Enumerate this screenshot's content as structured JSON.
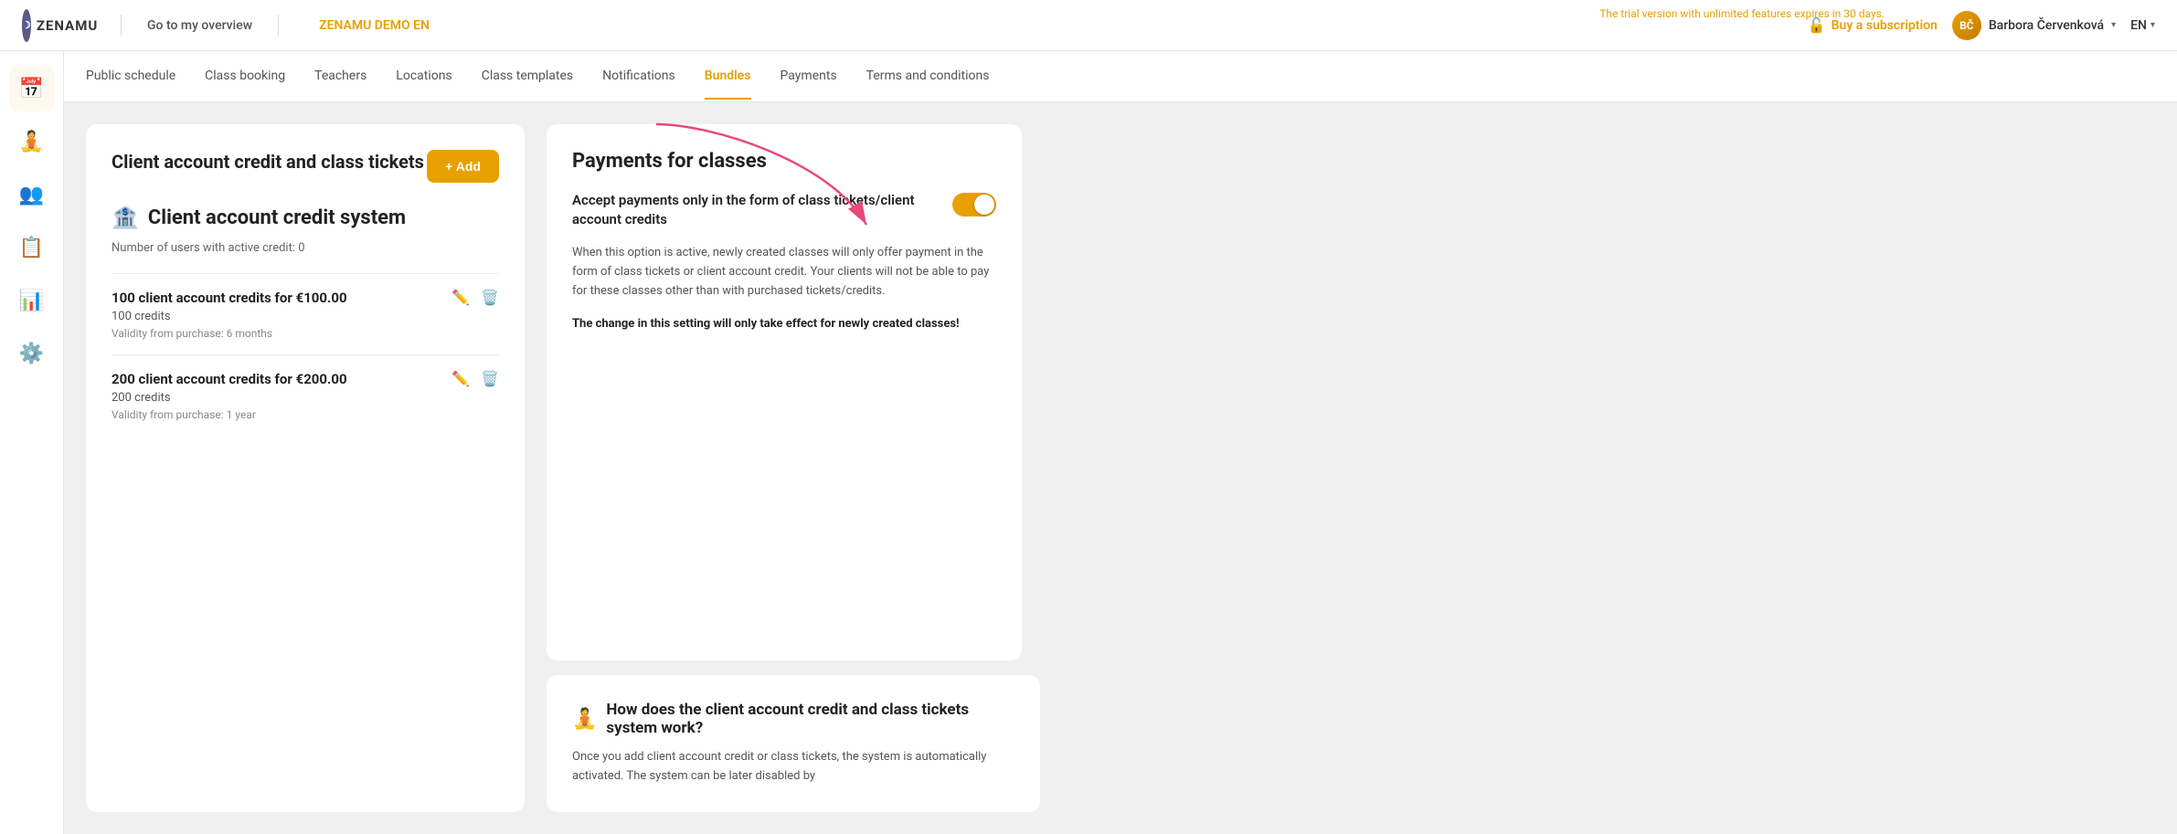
{
  "topbar": {
    "logo_text": "ZENAMU",
    "logo_initials": "Z",
    "go_to_overview": "Go to my overview",
    "demo_label": "ZENAMU DEMO EN",
    "trial_notice": "The trial version with unlimited features expires in 30 days.",
    "buy_subscription": "Buy a subscription",
    "user_initials": "BČ",
    "user_name": "Barbora Červenková",
    "language": "EN"
  },
  "nav_tabs": [
    {
      "id": "public-schedule",
      "label": "Public schedule",
      "active": false
    },
    {
      "id": "class-booking",
      "label": "Class booking",
      "active": false
    },
    {
      "id": "teachers",
      "label": "Teachers",
      "active": false
    },
    {
      "id": "locations",
      "label": "Locations",
      "active": false
    },
    {
      "id": "class-templates",
      "label": "Class templates",
      "active": false
    },
    {
      "id": "notifications",
      "label": "Notifications",
      "active": false
    },
    {
      "id": "bundles",
      "label": "Bundles",
      "active": true
    },
    {
      "id": "payments",
      "label": "Payments",
      "active": false
    },
    {
      "id": "terms",
      "label": "Terms and conditions",
      "active": false
    }
  ],
  "sidebar": {
    "items": [
      {
        "id": "calendar",
        "icon": "📅"
      },
      {
        "id": "person",
        "icon": "🧘"
      },
      {
        "id": "users",
        "icon": "👥"
      },
      {
        "id": "list",
        "icon": "📋"
      },
      {
        "id": "chart",
        "icon": "📊"
      },
      {
        "id": "settings",
        "icon": "⚙️"
      }
    ]
  },
  "left_card": {
    "title": "Client account credit and class tickets",
    "add_button": "+ Add",
    "section_icon": "🏦",
    "section_title": "Client account credit system",
    "users_info": "Number of users with active credit: 0",
    "credit_items": [
      {
        "title": "100 client account credits for €100.00",
        "credits": "100 credits",
        "validity": "Validity from purchase: 6 months"
      },
      {
        "title": "200 client account credits for €200.00",
        "credits": "200 credits",
        "validity": "Validity from purchase: 1 year"
      }
    ]
  },
  "right_card": {
    "title": "Payments for classes",
    "toggle_label": "Accept payments only in the form of class tickets/client account credits",
    "toggle_state": true,
    "description": "When this option is active, newly created classes will only offer payment in the form of class tickets or client account credit. Your clients will not be able to pay for these classes other than with purchased tickets/credits.",
    "warning": "The change in this setting will only take effect for newly created classes!"
  },
  "info_card": {
    "icon": "🧘",
    "title": "How does the client account credit and class tickets system work?",
    "description": "Once you add client account credit or class tickets, the system is automatically activated. The system can be later disabled by"
  }
}
